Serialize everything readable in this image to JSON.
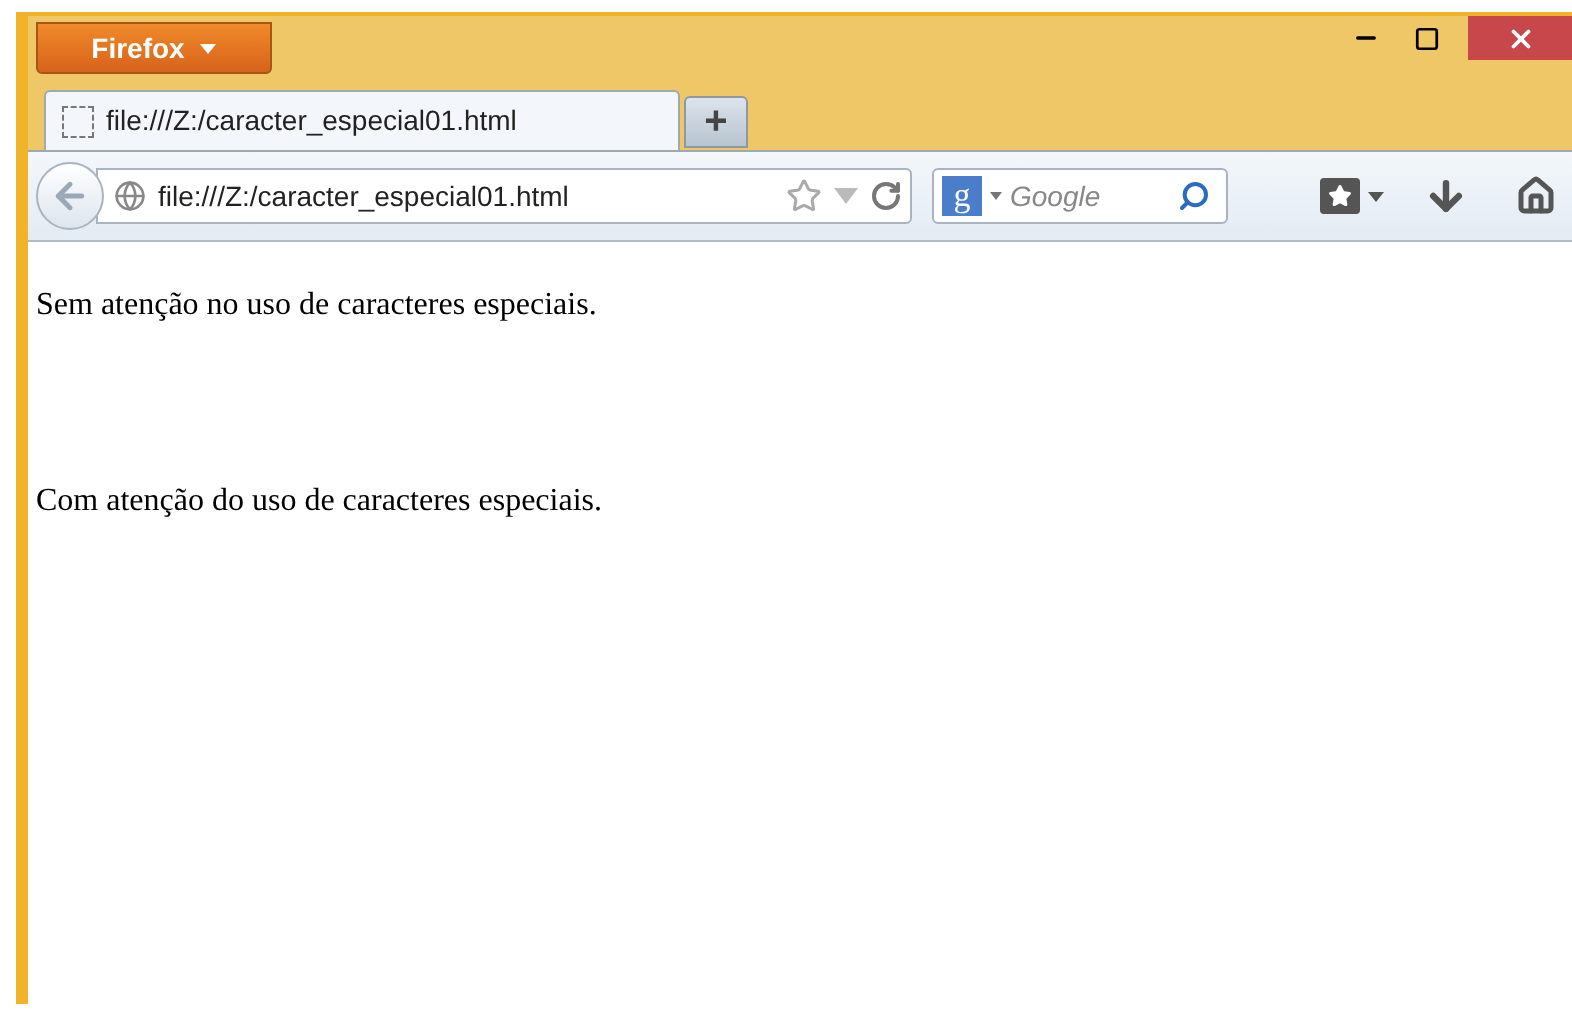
{
  "app_button": {
    "label": "Firefox"
  },
  "tabs": [
    {
      "title": "file:///Z:/caracter_especial01.html",
      "selected": true
    }
  ],
  "new_tab": {
    "label": "+"
  },
  "url_bar": {
    "value": "file:///Z:/caracter_especial01.html"
  },
  "search": {
    "engine_glyph": "g",
    "placeholder": "Google"
  },
  "content": {
    "paragraphs": [
      "Sem atenção no uso de caracteres especiais.",
      "Com atenção do uso de caracteres especiais."
    ]
  }
}
